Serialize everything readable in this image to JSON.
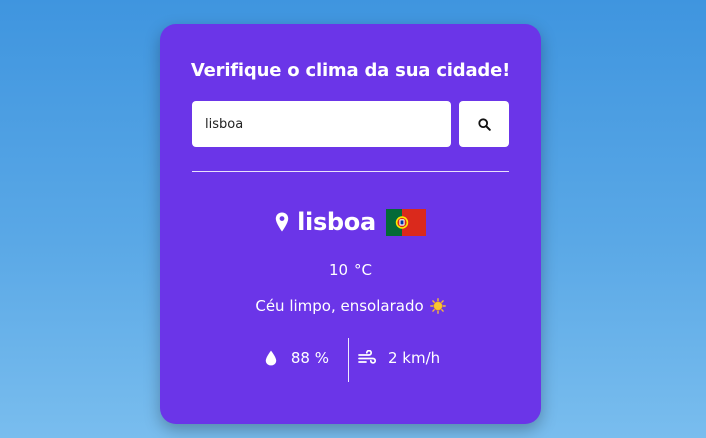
{
  "card": {
    "title": "Verifique o clima da sua cidade!",
    "search": {
      "value": "lisboa",
      "button_icon": "search-icon"
    },
    "result": {
      "city": "lisboa",
      "location_icon": "map-pin-icon",
      "flag_icon": "portugal-flag-icon",
      "temperature": "10",
      "temperature_unit": "°C",
      "description": "Céu limpo, ensolarado",
      "condition_icon": "sun-icon",
      "humidity": "88 %",
      "humidity_icon": "water-drop-icon",
      "wind": "2 km/h",
      "wind_icon": "wind-icon"
    }
  },
  "colors": {
    "background_top": "#3f95df",
    "background_bottom": "#79bdee",
    "card": "#6b35e8",
    "text": "#ffffff",
    "input_bg": "#ffffff"
  }
}
